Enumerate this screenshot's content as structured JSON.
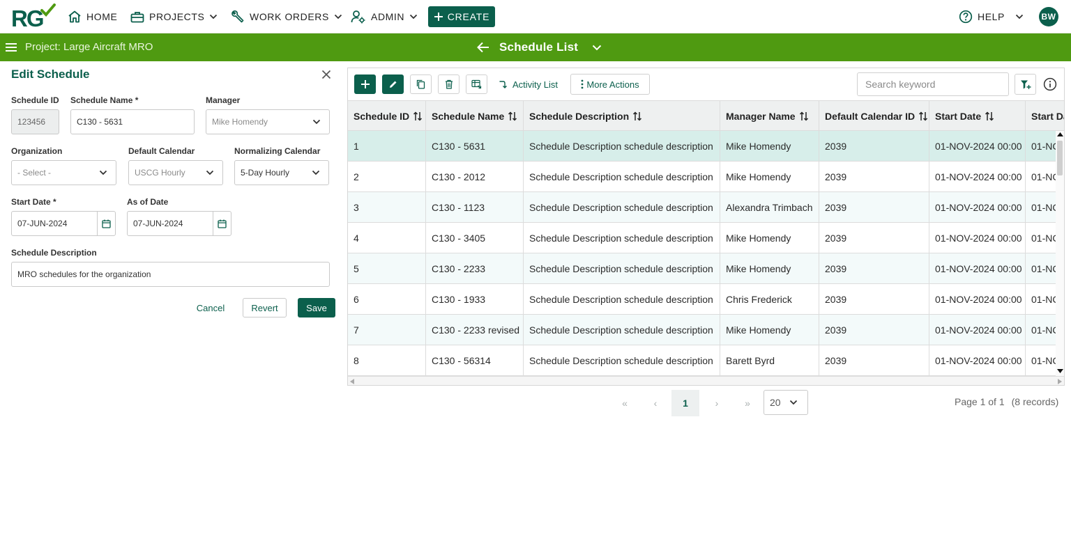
{
  "nav": {
    "logo_text": "RG",
    "home": "HOME",
    "projects": "PROJECTS",
    "work_orders": "WORK ORDERS",
    "admin": "ADMIN",
    "create": "CREATE",
    "help": "HELP",
    "user_initials": "BW"
  },
  "bar": {
    "project": "Project: Large Aircraft MRO",
    "view_title": "Schedule List"
  },
  "edit": {
    "title": "Edit Schedule",
    "schedule_id_label": "Schedule ID",
    "schedule_id_value": "123456",
    "schedule_name_label": "Schedule Name *",
    "schedule_name_value": "C130 - 5631",
    "manager_label": "Manager",
    "manager_value": "Mike Homendy",
    "organization_label": "Organization",
    "organization_value": "- Select -",
    "default_calendar_label": "Default Calendar",
    "default_calendar_value": "USCG Hourly",
    "normalizing_calendar_label": "Normalizing Calendar",
    "normalizing_calendar_value": "5-Day Hourly",
    "start_date_label": "Start Date *",
    "start_date_value": "07-JUN-2024",
    "as_of_date_label": "As of Date",
    "as_of_date_value": "07-JUN-2024",
    "description_label": "Schedule Description",
    "description_value": "MRO schedules for the organization",
    "cancel": "Cancel",
    "revert": "Revert",
    "save": "Save"
  },
  "toolbar": {
    "activity_list": "Activity List",
    "more_actions": "More Actions",
    "search_placeholder": "Search keyword"
  },
  "table": {
    "columns": [
      "Schedule ID",
      "Schedule Name",
      "Schedule Description",
      "Manager Name",
      "Default Calendar ID",
      "Start Date",
      "Start Da"
    ],
    "rows": [
      [
        "1",
        "C130 - 5631",
        "Schedule Description schedule description",
        "Mike Homendy",
        "2039",
        "01-NOV-2024 00:00",
        "01-NC"
      ],
      [
        "2",
        "C130 - 2012",
        "Schedule Description schedule description",
        "Mike Homendy",
        "2039",
        "01-NOV-2024 00:00",
        "01-NC"
      ],
      [
        "3",
        "C130 - 1123",
        "Schedule Description schedule description",
        "Alexandra Trimbach",
        "2039",
        "01-NOV-2024 00:00",
        "01-NC"
      ],
      [
        "4",
        "C130 - 3405",
        "Schedule Description schedule description",
        "Mike Homendy",
        "2039",
        "01-NOV-2024 00:00",
        "01-NC"
      ],
      [
        "5",
        "C130 - 2233",
        "Schedule Description schedule description",
        "Mike Homendy",
        "2039",
        "01-NOV-2024 00:00",
        "01-NC"
      ],
      [
        "6",
        "C130 - 1933",
        "Schedule Description schedule description",
        "Chris Frederick",
        "2039",
        "01-NOV-2024 00:00",
        "01-NC"
      ],
      [
        "7",
        "C130 - 2233 revised",
        "Schedule Description schedule description",
        "Mike Homendy",
        "2039",
        "01-NOV-2024 00:00",
        "01-NC"
      ],
      [
        "8",
        "C130 - 56314",
        "Schedule Description schedule description",
        "Barett Byrd",
        "2039",
        "01-NOV-2024 00:00",
        "01-NC"
      ]
    ],
    "selected_row": 0
  },
  "pagination": {
    "first": "«",
    "prev": "‹",
    "current": "1",
    "next": "›",
    "last": "»",
    "page_size": "20",
    "page_info": "Page 1 of 1",
    "records": "(8 records)"
  },
  "colors": {
    "brand": "#0b5f4c",
    "bar": "#4f9a11",
    "selected_row": "#d7eeea"
  }
}
